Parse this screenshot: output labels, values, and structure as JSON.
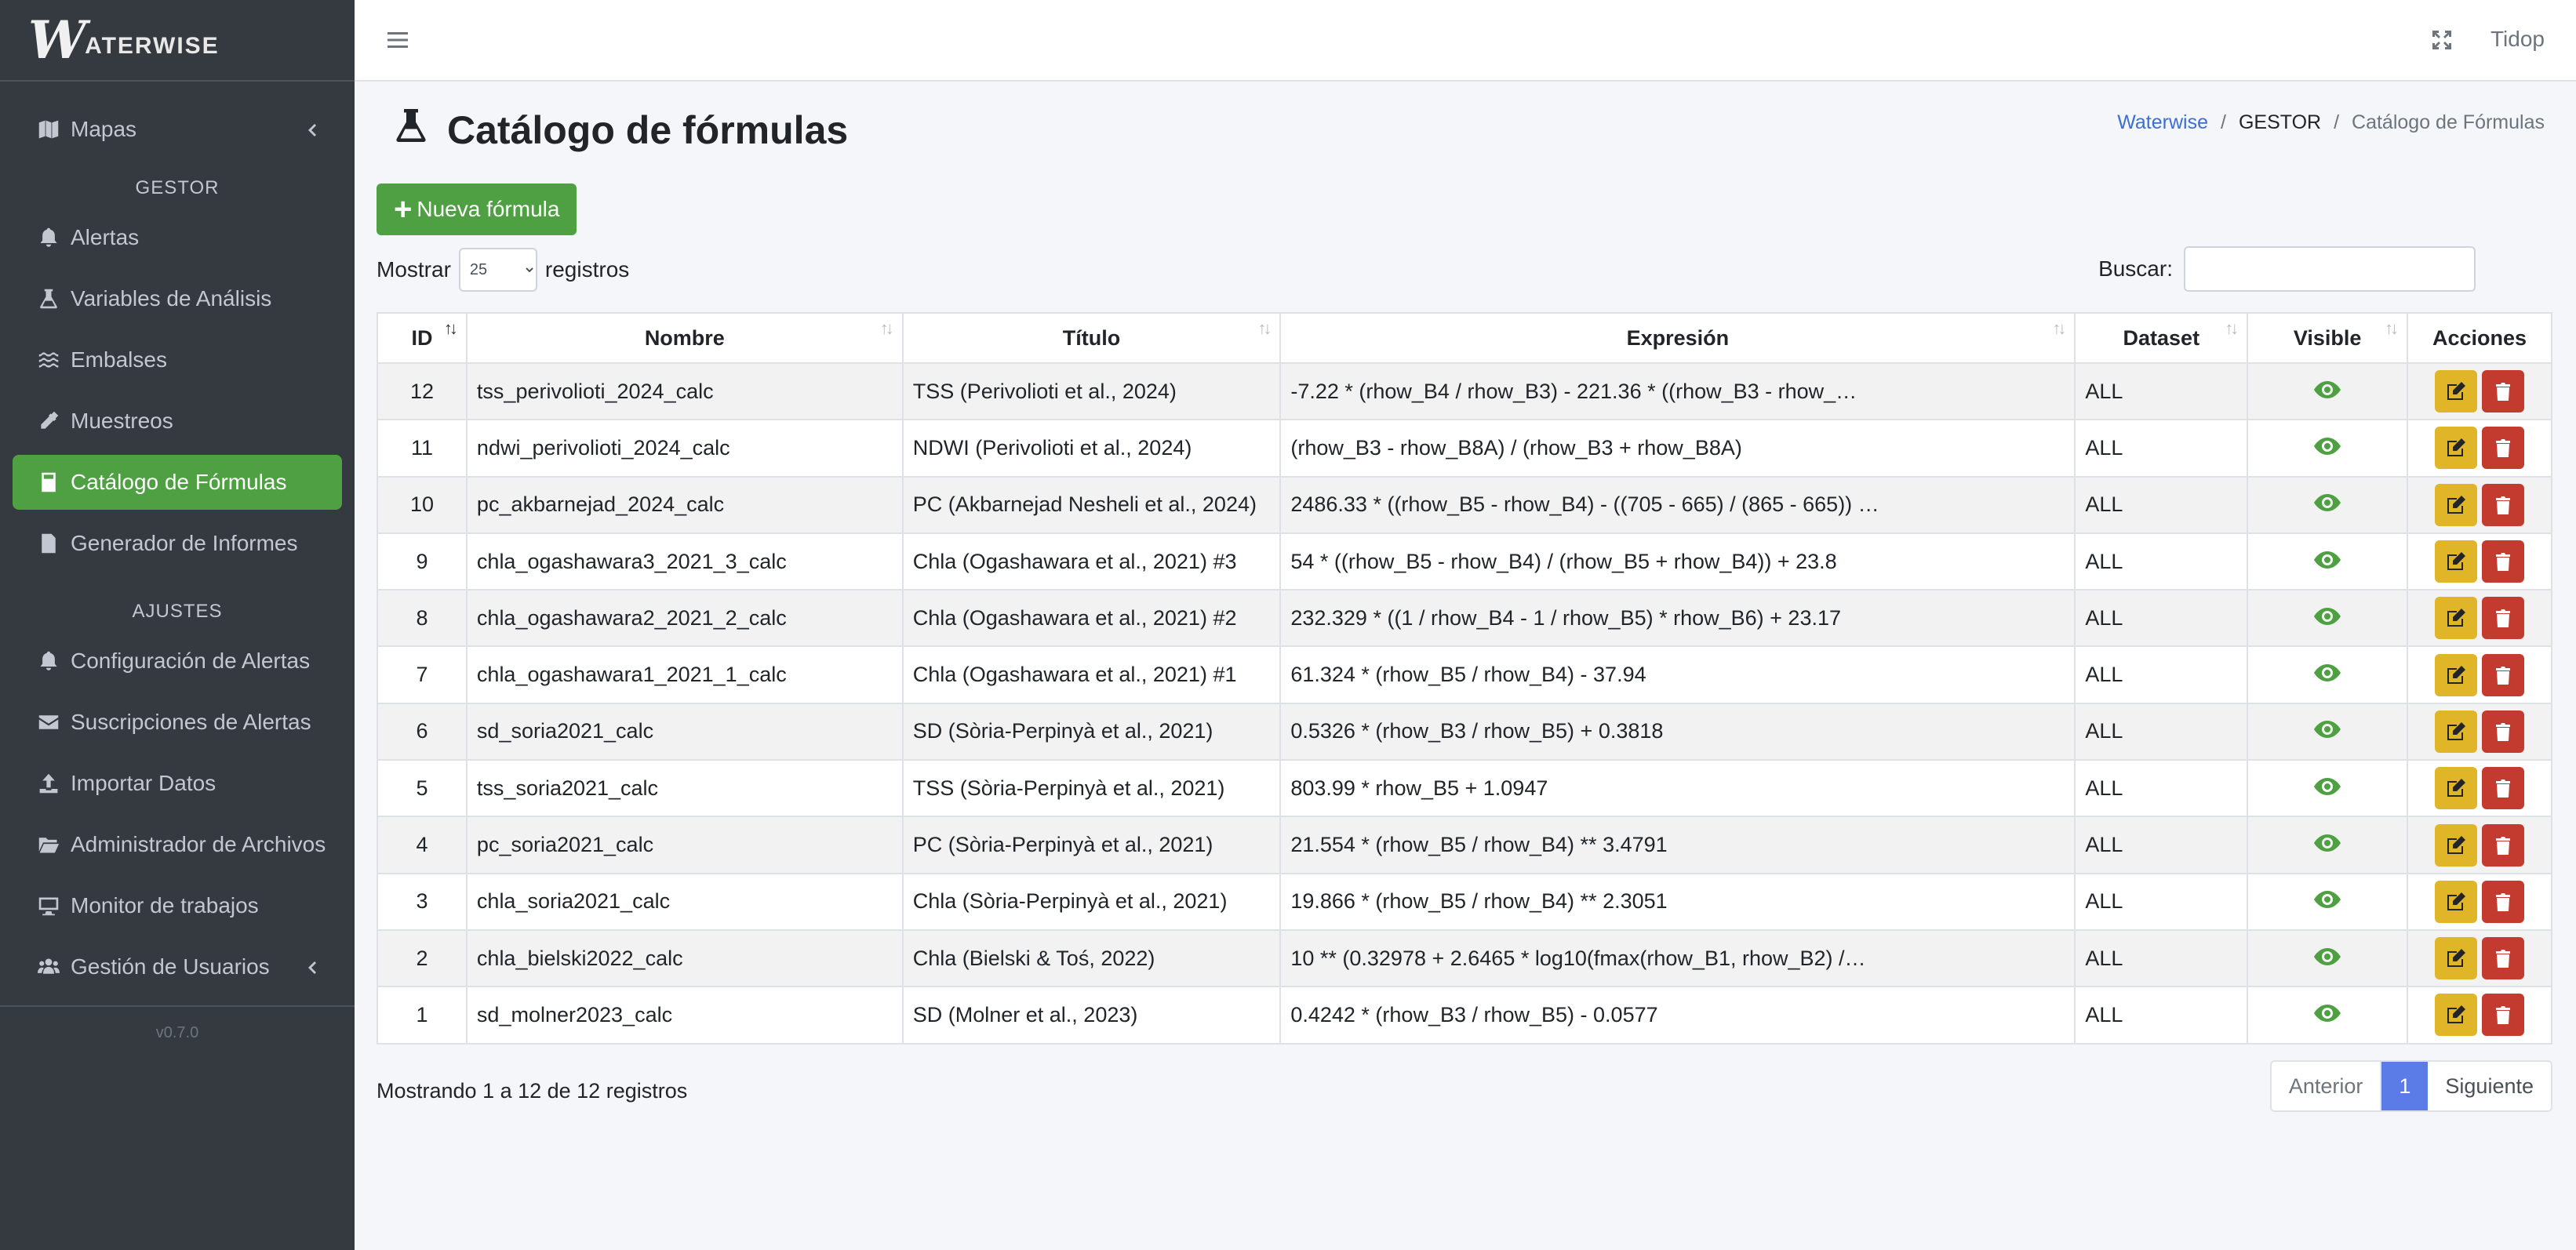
{
  "brand": {
    "letter": "W",
    "text": "ATERWISE"
  },
  "sidebar": {
    "items": [
      {
        "label": "Mapas",
        "icon": "map-icon"
      },
      {
        "label": "Alertas",
        "icon": "bell-icon"
      },
      {
        "label": "Variables de Análisis",
        "icon": "flask-icon"
      },
      {
        "label": "Embalses",
        "icon": "water-icon"
      },
      {
        "label": "Muestreos",
        "icon": "eyedropper-icon"
      },
      {
        "label": "Catálogo de Fórmulas",
        "icon": "calculator-icon"
      },
      {
        "label": "Generador de Informes",
        "icon": "file-icon"
      },
      {
        "label": "Configuración de Alertas",
        "icon": "bell-icon"
      },
      {
        "label": "Suscripciones de Alertas",
        "icon": "envelope-icon"
      },
      {
        "label": "Importar Datos",
        "icon": "upload-icon"
      },
      {
        "label": "Administrador de Archivos",
        "icon": "folder-icon"
      },
      {
        "label": "Monitor de trabajos",
        "icon": "desktop-icon"
      },
      {
        "label": "Gestión de Usuarios",
        "icon": "users-icon"
      }
    ],
    "header_gestor": "GESTOR",
    "header_ajustes": "AJUSTES",
    "version": "v0.7.0"
  },
  "topbar": {
    "user": "Tidop"
  },
  "page": {
    "title": "Catálogo de fórmulas",
    "breadcrumb": [
      "Waterwise",
      "/",
      "GESTOR",
      "/",
      "Catálogo de Fórmulas"
    ],
    "new_button": "Nueva fórmula",
    "length_prefix": "Mostrar",
    "length_value": "25",
    "length_suffix": "registros",
    "search_label": "Buscar:",
    "info": "Mostrando 1 a 12 de 12 registros",
    "pagination": {
      "prev": "Anterior",
      "current": "1",
      "next": "Siguiente"
    }
  },
  "table": {
    "columns": [
      "ID",
      "Nombre",
      "Título",
      "Expresión",
      "Dataset",
      "Visible",
      "Acciones"
    ],
    "rows": [
      {
        "id": "12",
        "nombre": "tss_perivolioti_2024_calc",
        "titulo": "TSS (Perivolioti et al., 2024)",
        "expr": "-7.22 * (rhow_B4 / rhow_B3) - 221.36 * ((rhow_B3 - rhow_…",
        "dataset": "ALL"
      },
      {
        "id": "11",
        "nombre": "ndwi_perivolioti_2024_calc",
        "titulo": "NDWI (Perivolioti et al., 2024)",
        "expr": "(rhow_B3 - rhow_B8A) / (rhow_B3 + rhow_B8A)",
        "dataset": "ALL"
      },
      {
        "id": "10",
        "nombre": "pc_akbarnejad_2024_calc",
        "titulo": "PC (Akbarnejad Nesheli et al., 2024)",
        "expr": "2486.33 * ((rhow_B5 - rhow_B4) - ((705 - 665) / (865 - 665)) …",
        "dataset": "ALL"
      },
      {
        "id": "9",
        "nombre": "chla_ogashawara3_2021_3_calc",
        "titulo": "Chla (Ogashawara et al., 2021) #3",
        "expr": "54 * ((rhow_B5 - rhow_B4) / (rhow_B5 + rhow_B4)) + 23.8",
        "dataset": "ALL"
      },
      {
        "id": "8",
        "nombre": "chla_ogashawara2_2021_2_calc",
        "titulo": "Chla (Ogashawara et al., 2021) #2",
        "expr": "232.329 * ((1 / rhow_B4 - 1 / rhow_B5) * rhow_B6) + 23.17",
        "dataset": "ALL"
      },
      {
        "id": "7",
        "nombre": "chla_ogashawara1_2021_1_calc",
        "titulo": "Chla (Ogashawara et al., 2021) #1",
        "expr": "61.324 * (rhow_B5 / rhow_B4) - 37.94",
        "dataset": "ALL"
      },
      {
        "id": "6",
        "nombre": "sd_soria2021_calc",
        "titulo": "SD (Sòria-Perpinyà et al., 2021)",
        "expr": "0.5326 * (rhow_B3 / rhow_B5) + 0.3818",
        "dataset": "ALL"
      },
      {
        "id": "5",
        "nombre": "tss_soria2021_calc",
        "titulo": "TSS (Sòria-Perpinyà et al., 2021)",
        "expr": "803.99 * rhow_B5 + 1.0947",
        "dataset": "ALL"
      },
      {
        "id": "4",
        "nombre": "pc_soria2021_calc",
        "titulo": "PC (Sòria-Perpinyà et al., 2021)",
        "expr": "21.554 * (rhow_B5 / rhow_B4) ** 3.4791",
        "dataset": "ALL"
      },
      {
        "id": "3",
        "nombre": "chla_soria2021_calc",
        "titulo": "Chla (Sòria-Perpinyà et al., 2021)",
        "expr": "19.866 * (rhow_B5 / rhow_B4) ** 2.3051",
        "dataset": "ALL"
      },
      {
        "id": "2",
        "nombre": "chla_bielski2022_calc",
        "titulo": "Chla (Bielski & Toś, 2022)",
        "expr": "10 ** (0.32978 + 2.6465 * log10(fmax(rhow_B1, rhow_B2) /…",
        "dataset": "ALL"
      },
      {
        "id": "1",
        "nombre": "sd_molner2023_calc",
        "titulo": "SD (Molner et al., 2023)",
        "expr": "0.4242 * (rhow_B3 / rhow_B5) - 0.0577",
        "dataset": "ALL"
      }
    ]
  },
  "colors": {
    "accent": "#4fa042",
    "sidebar_bg": "#343a40",
    "edit": "#e0b527",
    "delete": "#c33a2f",
    "page_active": "#5b7be6"
  }
}
